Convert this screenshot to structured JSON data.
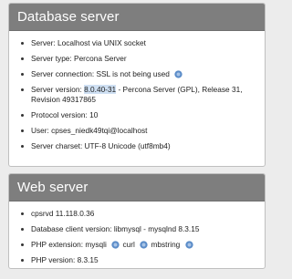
{
  "database_server": {
    "title": "Database server",
    "server": "Server: Localhost via UNIX socket",
    "server_type": "Server type: Percona Server",
    "server_connection": "Server connection: SSL is not being used",
    "server_version_label": "Server version: ",
    "server_version_value": "8.0.40-31",
    "server_version_rest": " - Percona Server (GPL), Release 31, Revision 49317865",
    "protocol_version": "Protocol version: 10",
    "user": "User: cpses_niedk49tqi@localhost",
    "charset": "Server charset: UTF-8 Unicode (utf8mb4)"
  },
  "web_server": {
    "title": "Web server",
    "software": "cpsrvd 11.118.0.36",
    "db_client": "Database client version: libmysql - mysqlnd 8.3.15",
    "php_ext_label": "PHP extension: ",
    "php_ext_1": "mysqli",
    "php_ext_2": "curl",
    "php_ext_3": "mbstring",
    "php_version": "PHP version: 8.3.15"
  },
  "icons": {
    "help": "help-icon",
    "accent": "#5b8cc8"
  }
}
